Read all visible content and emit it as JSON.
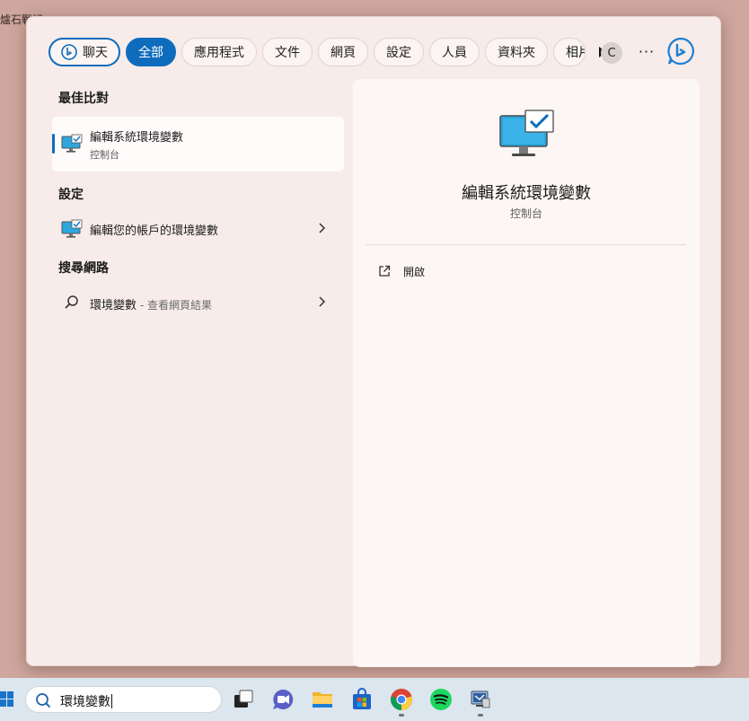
{
  "desktop": {
    "fragments": [
      "爐石戰記",
      "",
      "",
      "",
      "",
      "",
      ""
    ]
  },
  "filters": {
    "chat": "聊天",
    "all": "全部",
    "apps": "應用程式",
    "documents": "文件",
    "web": "網頁",
    "settings": "設定",
    "people": "人員",
    "folders": "資料夾",
    "photos_cut": "相片",
    "avatar_letter": "C",
    "more": "···"
  },
  "results": {
    "best_match_heading": "最佳比對",
    "best_match": {
      "title": "編輯系統環境變數",
      "subtitle": "控制台"
    },
    "settings_heading": "設定",
    "settings_item": {
      "title": "編輯您的帳戶的環境變數"
    },
    "web_heading": "搜尋網路",
    "web_item": {
      "query": "環境變數",
      "hint": " - 查看網頁結果"
    }
  },
  "preview": {
    "title": "編輯系統環境變數",
    "subtitle": "控制台",
    "open_label": "開啟"
  },
  "taskbar": {
    "search_value": "環境變數"
  },
  "colors": {
    "accent": "#0f6cbd",
    "panel": "#f7ece9",
    "desktop": "#cfa79e",
    "taskbar": "#dbe6ee"
  }
}
